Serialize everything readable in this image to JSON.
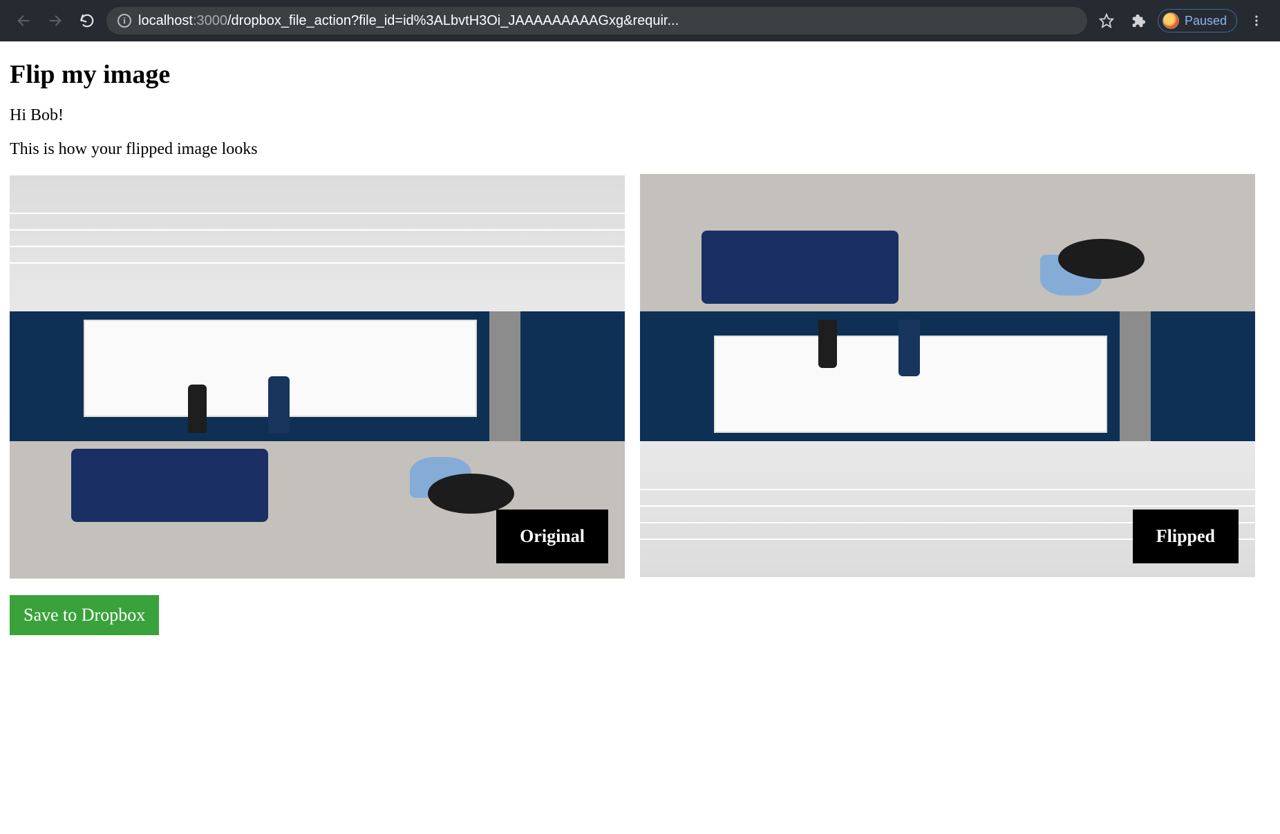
{
  "browser": {
    "url_host": "localhost",
    "url_port": ":3000",
    "url_path": "/dropbox_file_action?file_id=id%3ALbvtH3Oi_JAAAAAAAAAGxg&requir...",
    "paused_label": "Paused"
  },
  "page": {
    "title": "Flip my image",
    "greeting": "Hi Bob!",
    "description": "This is how your flipped image looks",
    "original_label": "Original",
    "flipped_label": "Flipped",
    "save_button_label": "Save to Dropbox"
  }
}
